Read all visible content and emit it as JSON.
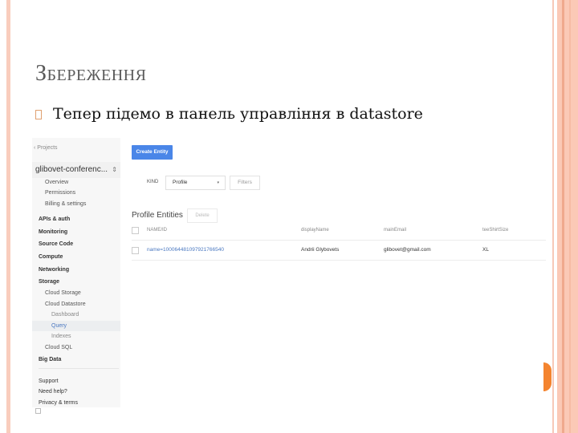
{
  "slide": {
    "title": "Збереження",
    "bullet_icon": "square-bullet-icon",
    "bullet_text": "Тепер підемо в панель управління в datastore"
  },
  "colors": {
    "accent_orange": "#f4842f",
    "stripe_peach": "#fbc9b6",
    "console_primary": "#4a86e8",
    "link_blue": "#4a78c0"
  },
  "console": {
    "sidebar": {
      "back_link": "‹ Projects",
      "project_name": "glibovet-conferenc...",
      "project_switch_icon": "⇕",
      "items": [
        {
          "label": "Overview",
          "level": 1
        },
        {
          "label": "Permissions",
          "level": 1
        },
        {
          "label": "Billing & settings",
          "level": 1
        },
        {
          "label": "APIs & auth",
          "level": 0
        },
        {
          "label": "Monitoring",
          "level": 0
        },
        {
          "label": "Source Code",
          "level": 0
        },
        {
          "label": "Compute",
          "level": 0
        },
        {
          "label": "Networking",
          "level": 0
        },
        {
          "label": "Storage",
          "level": 0
        },
        {
          "label": "Cloud Storage",
          "level": 1
        },
        {
          "label": "Cloud Datastore",
          "level": 1
        },
        {
          "label": "Dashboard",
          "level": 2
        },
        {
          "label": "Query",
          "level": 2,
          "active": true
        },
        {
          "label": "Indexes",
          "level": 2
        },
        {
          "label": "Cloud SQL",
          "level": 1
        },
        {
          "label": "Big Data",
          "level": 0
        }
      ],
      "footer": [
        {
          "label": "Support"
        },
        {
          "label": "Need help?"
        },
        {
          "label": "Privacy & terms"
        }
      ]
    },
    "main": {
      "create_button": "Create Entity",
      "kind_label": "KIND",
      "kind_value": "Profile",
      "kind_caret": "▾",
      "filters_button": "Filters",
      "entities_title": "Profile Entities",
      "delete_button": "Delete",
      "table": {
        "columns": [
          "NAME/ID",
          "displayName",
          "mainEmail",
          "teeShirtSize"
        ],
        "rows": [
          [
            "name=100064481097921766540",
            "Andrii Glybovets",
            "glibovet@gmail.com",
            "XL"
          ]
        ]
      }
    }
  }
}
